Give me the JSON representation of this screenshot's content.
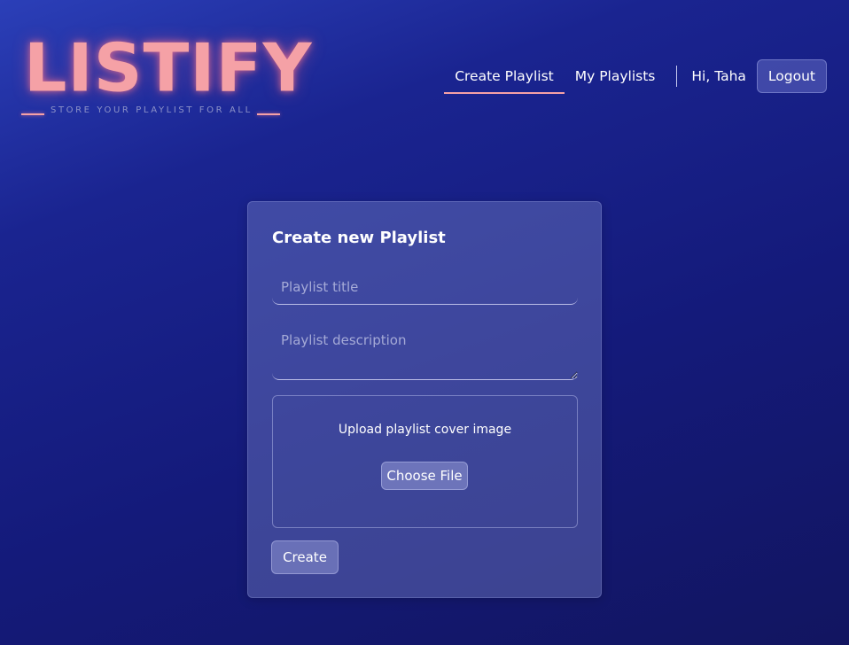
{
  "brand": {
    "name": "LISTIFY",
    "tagline": "STORE YOUR PLAYLIST FOR ALL",
    "color": "#f5a1a6"
  },
  "nav": {
    "links": [
      {
        "label": "Create Playlist",
        "active": true
      },
      {
        "label": "My Playlists",
        "active": false
      }
    ],
    "greeting": "Hi, Taha",
    "logout_label": "Logout"
  },
  "form": {
    "title": "Create new Playlist",
    "title_placeholder": "Playlist title",
    "description_placeholder": "Playlist description",
    "upload_label": "Upload playlist cover image",
    "choose_file_label": "Choose File",
    "submit_label": "Create"
  }
}
